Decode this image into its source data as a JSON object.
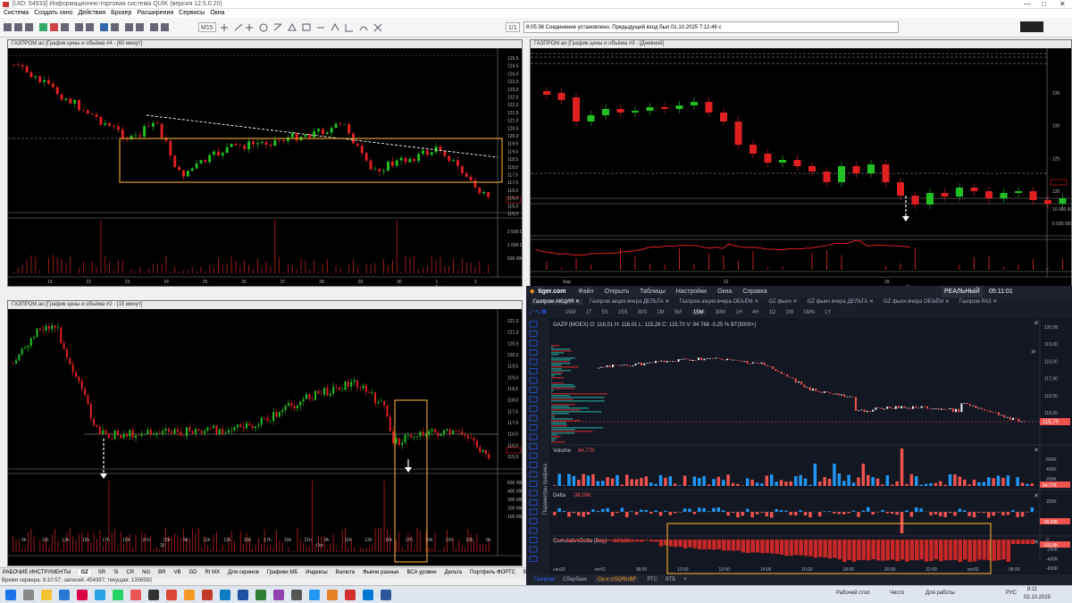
{
  "window": {
    "title": "[UID: 54933] Информационно-торговая система QUIK (версия 12.5.0.20)"
  },
  "menu": [
    "Система",
    "Создать окно",
    "Действия",
    "Брокер",
    "Расширения",
    "Сервисы",
    "Окна"
  ],
  "toolbar": {
    "interval": "M15",
    "page": "1/1",
    "connection": "8:05:36 Соединение установлено. Предыдущий вход был 01.10.2025 7:12:46 с"
  },
  "panels": {
    "p1": {
      "title": "ГАЗПРОМ ао [График цены и объёма #4 - [60 минут]",
      "yaxis": [
        "125,5",
        "124,5",
        "124,0",
        "123,5",
        "123,0",
        "122,5",
        "122,0",
        "121,5",
        "121,0",
        "120,5",
        "120,0",
        "119,5",
        "119,0",
        "118,5",
        "118,0",
        "117,5",
        "117,0",
        "116,5",
        "116,0",
        "115,5",
        "115,0"
      ],
      "vol": [
        "2 500 000",
        "1 000 000",
        "500 000"
      ],
      "xaxis": [
        "19",
        "22",
        "23",
        "24",
        "25",
        "26",
        "27",
        "28",
        "29",
        "30",
        "1",
        "2"
      ],
      "month": "Oct"
    },
    "p2": {
      "title": "ГАЗПРОМ ао [График цены и объёма #3 - [Дневной]",
      "yaxis": [
        "135",
        "130",
        "125",
        "120"
      ],
      "vol": [
        "10 000 000",
        "5 000 000"
      ],
      "ind": [
        "3,0"
      ],
      "xaxis": [
        "Sep",
        "22",
        "29"
      ],
      "month": "Oct"
    },
    "p3": {
      "title": "ГАЗПРОМ ао [График цены и объёма #2 - [15 минут]",
      "yaxis": [
        "121,5",
        "121,0",
        "120,5",
        "120,0",
        "119,5",
        "119,0",
        "118,5",
        "118,0",
        "117,5",
        "117,0",
        "116,5",
        "116,0",
        "115,5"
      ],
      "vol": [
        "600 000",
        "400 000",
        "300 000",
        "200 000",
        "100 000"
      ],
      "xaxis": [
        "9h",
        "11h",
        "13h",
        "15h",
        "17h",
        "19h",
        "21h",
        "23h",
        "9h",
        "11h",
        "13h",
        "15h",
        "17h",
        "19h",
        "21h",
        "9h",
        "11h",
        "13h",
        "15h",
        "17h",
        "19h",
        "21h",
        "23h",
        "9h"
      ],
      "month_marks": [
        "30",
        "Oct"
      ]
    }
  },
  "tiger": {
    "brand": "tiger.com",
    "menu": [
      "Файл",
      "Открыть",
      "Таблицы",
      "Настройки",
      "Окна",
      "Справка"
    ],
    "mode": "РЕАЛЬНЫЙ",
    "clock": "05:11:01",
    "tabs": [
      "Газпром АКЦИЯ",
      "Газпром акция вчера ДЕЛЬТА",
      "Газпром акция вчера ОБЪЁМ",
      "GZ фьюч",
      "GZ фьюч вчера ДЕЛЬТА",
      "GZ фьюч вчера ОБЪЁМ",
      "Газпром РАЗ"
    ],
    "timeframes": [
      "15М",
      "1T",
      "5S",
      "15S",
      "30S",
      "1М",
      "5М",
      "15М",
      "30М",
      "1H",
      "4H",
      "1D",
      "1W",
      "1MN",
      "1Y"
    ],
    "ohlc": "GAZP (MOEX) O: 116,01 H: 116,01 L: 115,26 C: 115,70 V: 94 768 -0,25 % BT(5000+)",
    "yaxis": [
      "120,00",
      "119,00",
      "118,00",
      "117,00",
      "116,00",
      "115,00"
    ],
    "price_last": "115,70",
    "side_label": "Параметры графика",
    "volume": {
      "label": "Volume",
      "value": "94,77K",
      "axis": [
        "600K",
        "400K",
        "200K"
      ],
      "last": "94,77K"
    },
    "delta": {
      "label": "Delta",
      "value": "-38,09K",
      "axis": [
        "200K",
        "-200K"
      ],
      "last": "-38,09K"
    },
    "cumdelta": {
      "label": "CumulativeDelta (Day)",
      "value": "-103,8K",
      "axis": [
        "0",
        "-200K",
        "-400K",
        "-600K"
      ],
      "last": "-103,8K"
    },
    "xaxis": [
      "сен30",
      "окт01",
      "08:00",
      "10:00",
      "12:00",
      "14:00",
      "16:00",
      "18:00",
      "20:00",
      "22:00",
      "окт02",
      "08:00"
    ],
    "bottom_tabs": [
      "Газпром",
      "Сбербанк",
      "Си и USDRUBF",
      "РТС",
      "ВТБ",
      "+"
    ]
  },
  "bottom_tabs": [
    "РАБОЧИЕ ИНСТРУМЕНТЫ",
    "GZ",
    "SR",
    "Si",
    "CR",
    "NG",
    "BR",
    "VB",
    "GD",
    "RI MX",
    "Для скринов",
    "Графики МБ",
    "Индексы",
    "Валюта",
    "Фьючи разные",
    "ВСА уровни",
    "Дельта",
    "Портфель ФОРТС",
    "Все"
  ],
  "status": "Время сервера: 8:10:57; записей: 454397; текущая: 1356592",
  "taskbar": {
    "items": [
      "Рабочий стол",
      "Чисто",
      "Для работы"
    ],
    "lang": "РУС",
    "time": "8:11",
    "date": "02.10.2025"
  }
}
